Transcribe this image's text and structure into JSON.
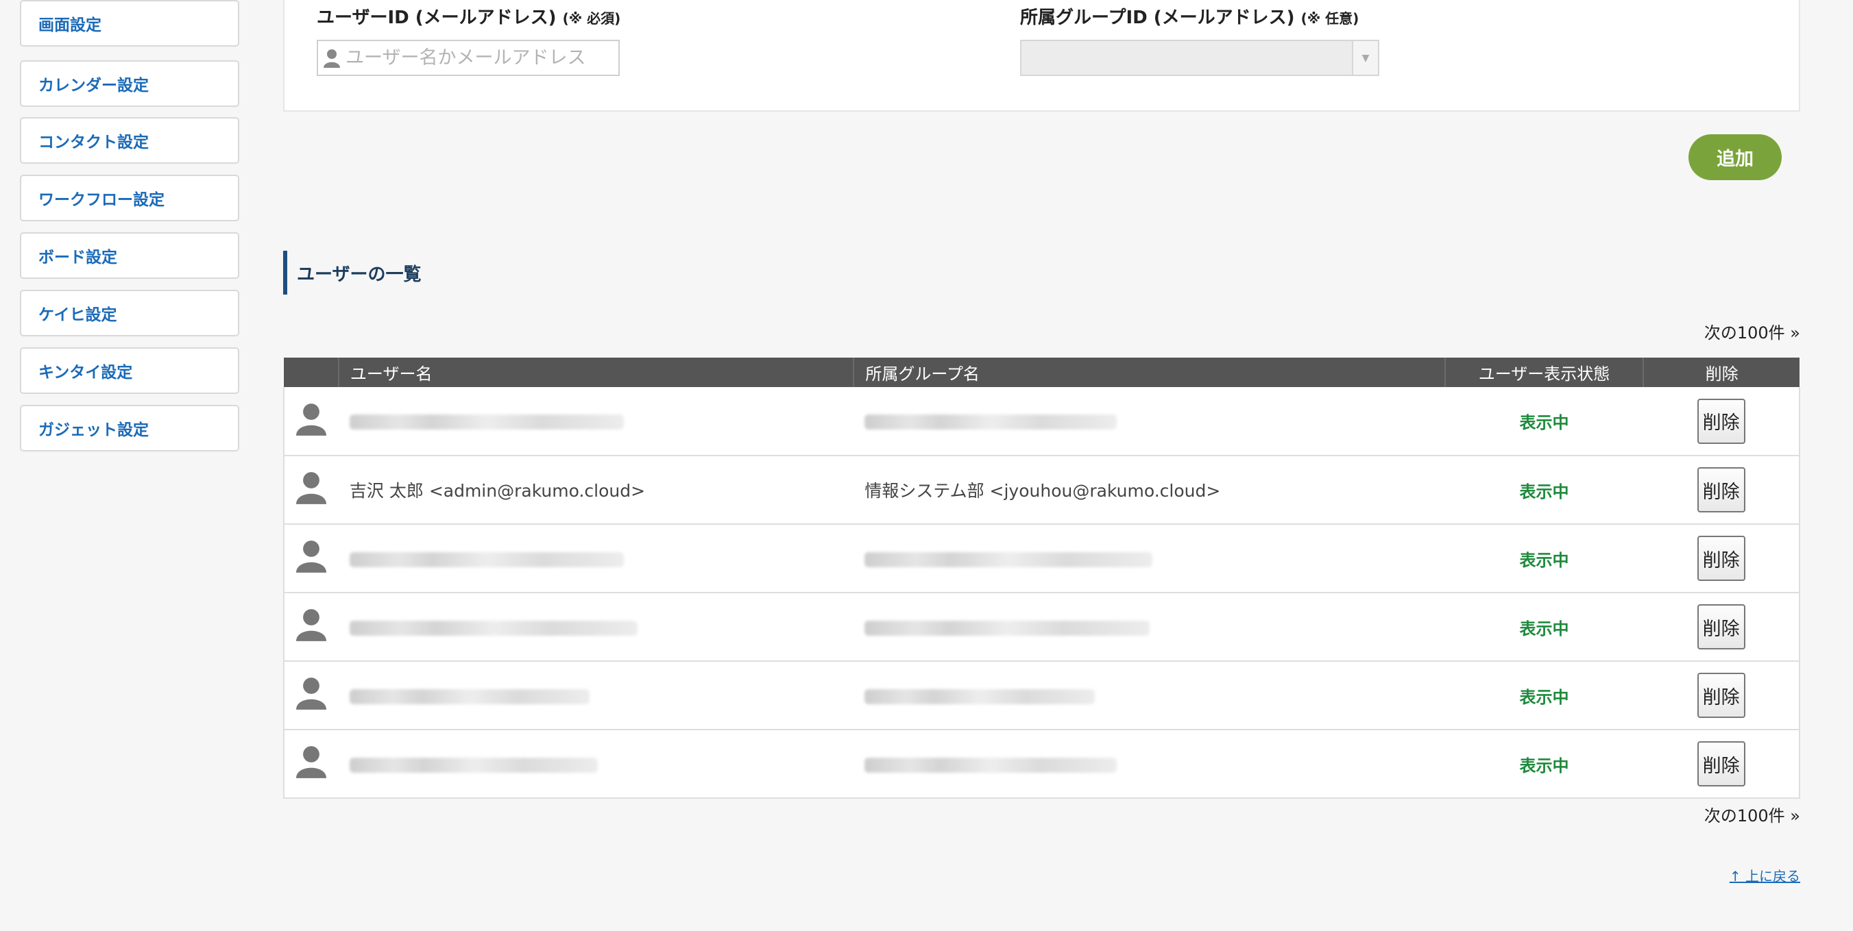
{
  "sidebar": {
    "items": [
      {
        "label": "画面設定"
      },
      {
        "label": "カレンダー設定"
      },
      {
        "label": "コンタクト設定"
      },
      {
        "label": "ワークフロー設定"
      },
      {
        "label": "ボード設定"
      },
      {
        "label": "ケイヒ設定"
      },
      {
        "label": "キンタイ設定"
      },
      {
        "label": "ガジェット設定"
      }
    ]
  },
  "form": {
    "user_id_label": "ユーザーID (メールアドレス)",
    "user_id_note": "(※ 必須)",
    "user_id_placeholder": "ユーザー名かメールアドレス",
    "group_id_label": "所属グループID (メールアドレス)",
    "group_id_note": "(※ 任意)",
    "group_id_value": "",
    "add_button": "追加"
  },
  "list": {
    "title": "ユーザーの一覧",
    "pager_next": "次の100件 »",
    "columns": [
      "ユーザー名",
      "所属グループ名",
      "ユーザー表示状態",
      "削除"
    ],
    "rows": [
      {
        "user": "",
        "group": "",
        "status": "表示中",
        "delete": "削除"
      },
      {
        "user": "吉沢 太郎 <admin@rakumo.cloud>",
        "group": "情報システム部 <jyouhou@rakumo.cloud>",
        "status": "表示中",
        "delete": "削除"
      },
      {
        "user": "",
        "group": "",
        "status": "表示中",
        "delete": "削除"
      },
      {
        "user": "",
        "group": "",
        "status": "表示中",
        "delete": "削除"
      },
      {
        "user": "",
        "group": "",
        "status": "表示中",
        "delete": "削除"
      },
      {
        "user": "",
        "group": "",
        "status": "表示中",
        "delete": "削除"
      }
    ],
    "back_to_top": "↑ 上に戻る"
  },
  "colors": {
    "link": "#1a6ab8",
    "add_button": "#7aa43b",
    "status": "#1e8a3c",
    "table_header": "#555555"
  }
}
